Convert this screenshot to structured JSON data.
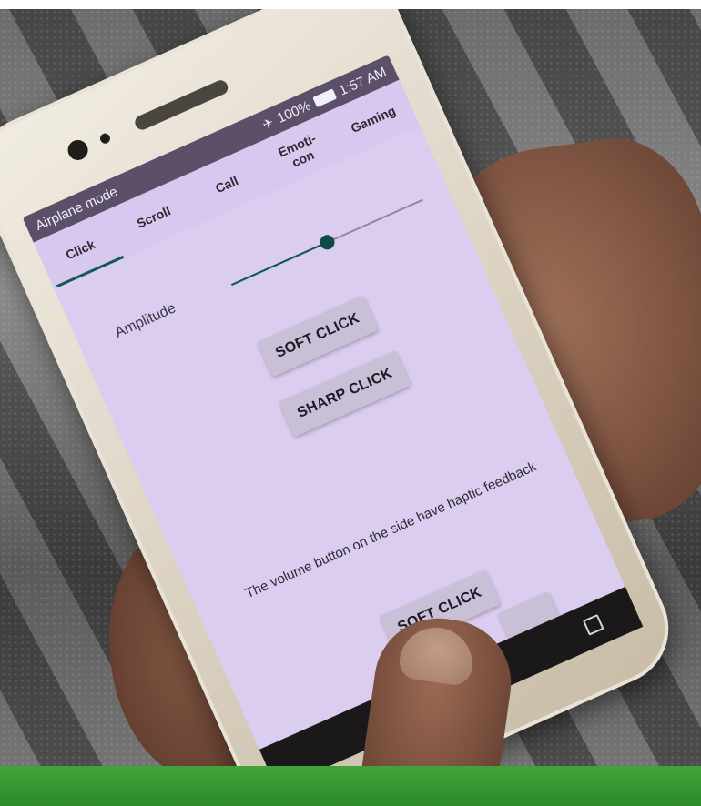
{
  "status_bar": {
    "left_text": "Airplane mode",
    "battery": "100%",
    "time": "1:57 AM",
    "icons": [
      "airplane-icon",
      "battery-icon"
    ]
  },
  "tabs": [
    {
      "label": "Click",
      "active": true
    },
    {
      "label": "Scroll",
      "active": false
    },
    {
      "label": "Call",
      "active": false
    },
    {
      "label": "Emoti-\ncon",
      "active": false
    },
    {
      "label": "Gaming",
      "active": false
    }
  ],
  "amplitude": {
    "label": "Amplitude",
    "value_fraction": 0.5
  },
  "buttons": {
    "soft_click": "SOFT CLICK",
    "sharp_click": "SHARP CLICK",
    "soft_click_bottom": "SOFT CLICK"
  },
  "haptic_text": "The volume button on the side have haptic feedback",
  "colors": {
    "accent": "#0d5b57",
    "screen_bg": "#dbcdf0",
    "status_bar_bg": "#5c5068",
    "button_bg": "#c9bfd6",
    "green_bar": "#3fa43a"
  },
  "nav_icons": [
    "recents-square-icon"
  ]
}
